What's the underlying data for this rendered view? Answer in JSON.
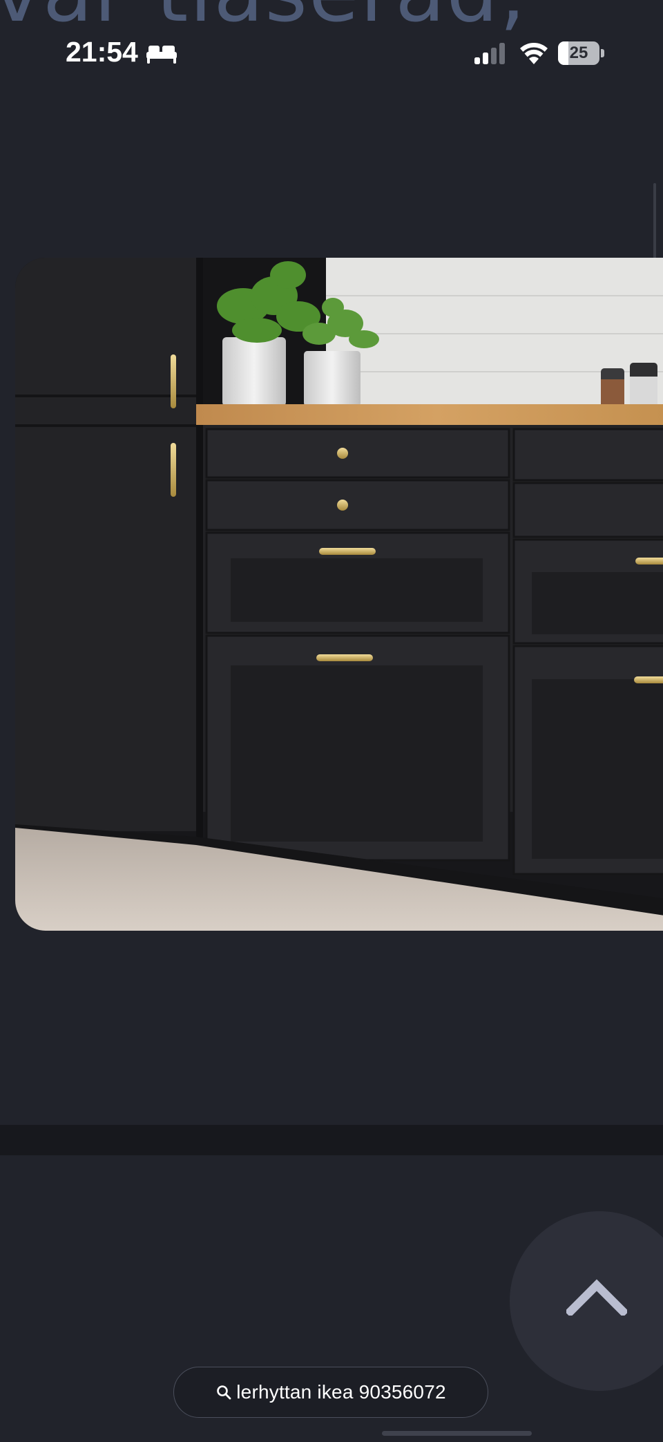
{
  "background_headline": "var tlaserad,",
  "status_bar": {
    "time": "21:54",
    "focus_icon": "bed-icon",
    "signal_icon": "cellular-signal-icon",
    "wifi_icon": "wifi-icon",
    "battery_level": "25",
    "battery_fraction": 0.25
  },
  "image": {
    "subject": "kitchen-cabinets-image"
  },
  "scroll_top_button": {
    "icon": "chevron-up-icon"
  },
  "search_chip": {
    "icon": "search-icon",
    "query": "lerhyttan ikea 90356072"
  },
  "colors": {
    "background": "#21232b",
    "headline": "#4d5a76",
    "fab": "#2d2f39",
    "chevron": "#b9bdd0"
  }
}
